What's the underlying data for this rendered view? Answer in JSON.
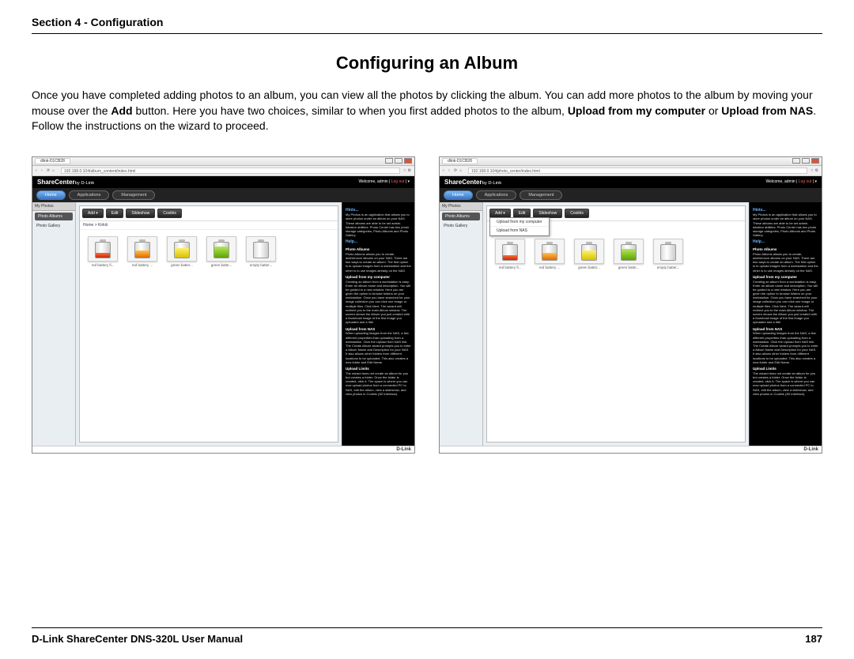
{
  "header": {
    "section_label": "Section 4 - Configuration"
  },
  "title": "Configuring an Album",
  "body": {
    "p1a": "Once you have completed adding photos to an album, you can view all the photos by clicking the album. You can add more photos to the album by moving your mouse over the ",
    "add": "Add",
    "p1b": " button. Here you have two choices, similar to when you first added photos to the album, ",
    "opt1": "Upload from my computer",
    "or": " or ",
    "opt2": "Upload from NAS",
    "p1c": ". Follow the instructions on the wizard to proceed."
  },
  "browser": {
    "tab_title": "dlink-D1CB28",
    "url1": "192.168.0.104/album_content/index.html",
    "url2": "192.168.0.104/photo_center/index.html"
  },
  "app": {
    "brand": "ShareCenter",
    "brand_sub": "by D-Link",
    "welcome": "Welcome, admin | ",
    "logout": "Log out",
    "nav": {
      "home": "Home",
      "applications": "Applications",
      "management": "Management"
    },
    "my_photos": "My Photos",
    "sidebar": {
      "item1": "Photo Albums",
      "item2": "Photo Gallery"
    },
    "toolbar": {
      "add": "Add ▾",
      "edit": "Edit",
      "slideshow": "Slideshow",
      "cooliris": "Cooliris"
    },
    "breadcrumb": "Home > Kirkiii",
    "dropdown": {
      "opt1": "Upload from my computer",
      "opt2": "Upload from NAS"
    },
    "thumbs": {
      "c1": "red battery fi...",
      "c2": "red battery ...",
      "c3": "green batter...",
      "c4": "green batte...",
      "c5": "empty batter..."
    },
    "help": {
      "hints": "Hints...",
      "hints_body": "My Photos is an application that allows you to store photos under an album on your NAS. These albums are able to be set admin-istration abilities. Photo Center has two photo storage categories, Photo Albums and Photo Gallery.",
      "help": "Help...",
      "pa": "Photo Albums",
      "pa_body": "Photo Albums allows you to create, add/remove albums on your NAS. There are two ways to create an album. The first option is to upload images from a workstation and the other is to use images already on the NAS.",
      "upc": "Upload from my computer",
      "upc_body": "Creating an album from a workstation is easy. Enter an album name and description.",
      "upc_body2": "You will be guided to a new window. Here you are given the option to browse folders on your workstation. Once you have searched for your image collection you can click one image or multiple files. Click Next. The wizard will redirect you to the main Album window. The screen shows the Album you just created with a thumbnail image of the first image you uploaded and a title.",
      "upn": "Upload from NAS",
      "upn_body": "When uploading images from the NAS, a few different properties than uploading from a workstation. Click the Upload from NAS link. The Create Album wizard prompts you to enter a Album Name and Description for your NAS. It also allows other folders from different locations to be uploaded. This also creates a new folder and Edit Name.",
      "upld": "Upload Limits",
      "upld_body": "The wizard does not create an album for you but creates a folder. Once the folder is created, click it. The space is where you can now upload photos from a connected PC to NAS, edit the album, view a slideshow, and view photos in Cooliris (3D interface)."
    },
    "footer_brand": "D-Link"
  },
  "footer": {
    "manual": "D-Link ShareCenter DNS-320L User Manual",
    "page": "187"
  }
}
